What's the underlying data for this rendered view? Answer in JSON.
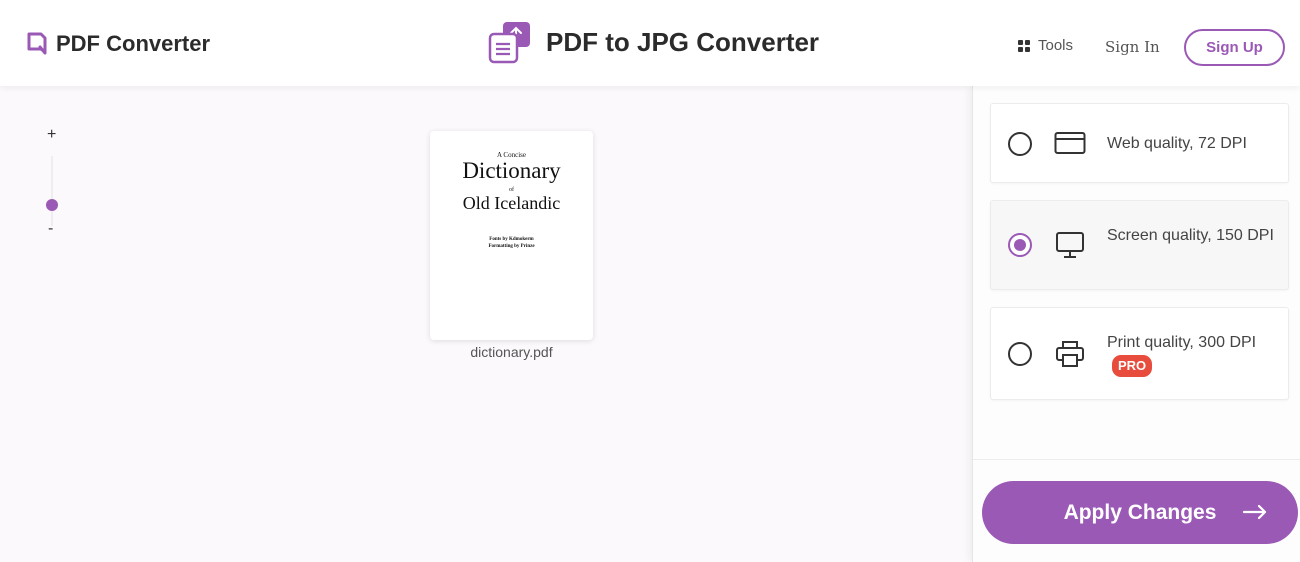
{
  "header": {
    "brand_name": "PDF Converter",
    "title": "PDF to JPG Converter",
    "tools_label": "Tools",
    "signin_label": "Sign In",
    "signup_label": "Sign Up"
  },
  "zoom": {
    "plus": "+",
    "minus": "-",
    "level": 0.3
  },
  "document": {
    "line1": "A Concise",
    "line2": "Dictionary",
    "line3": "of",
    "line4": "Old Icelandic",
    "credit1": "Fonts by Kdmokerm",
    "credit2": "Formatting by Prinze",
    "filename": "dictionary.pdf"
  },
  "options": [
    {
      "label": "Web quality, 72 DPI",
      "icon": "browser-window-icon",
      "selected": false
    },
    {
      "label": "Screen quality, 150 DPI",
      "icon": "monitor-icon",
      "selected": true
    },
    {
      "label": "Print quality, 300 DPI",
      "icon": "printer-icon",
      "selected": false,
      "badge": "PRO"
    }
  ],
  "apply_label": "Apply Changes",
  "colors": {
    "accent": "#9b59b6",
    "pro_badge": "#e74c3c"
  }
}
